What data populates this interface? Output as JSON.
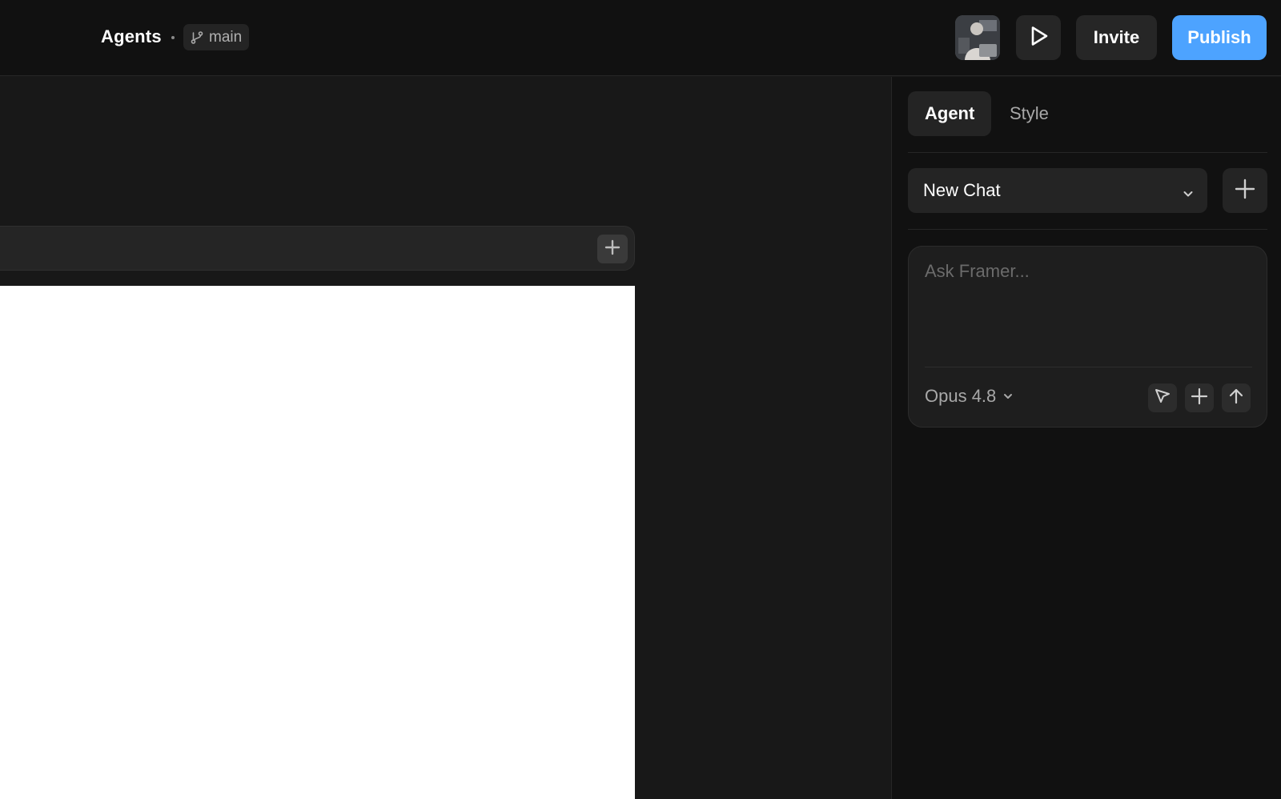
{
  "header": {
    "project_title": "Agents",
    "branch": {
      "label": "main",
      "icon": "git-branch-icon"
    },
    "avatar": {
      "icon": "user-avatar"
    },
    "play": {
      "icon": "play-icon"
    },
    "invite_label": "Invite",
    "publish_label": "Publish"
  },
  "canvas": {
    "frame_add": {
      "icon": "plus-icon"
    }
  },
  "panel": {
    "tabs": [
      {
        "label": "Agent",
        "active": true
      },
      {
        "label": "Style",
        "active": false
      }
    ],
    "chat_select": {
      "value": "New Chat",
      "icon": "chevron-down-icon"
    },
    "new_chat": {
      "icon": "plus-icon"
    },
    "prompt": {
      "placeholder": "Ask Framer...",
      "model": "Opus 4.8",
      "actions": [
        "cursor-icon",
        "plus-icon",
        "arrow-up-icon"
      ]
    }
  },
  "colors": {
    "accent": "#4da3ff",
    "background": "#181818",
    "panel": "#111111"
  }
}
